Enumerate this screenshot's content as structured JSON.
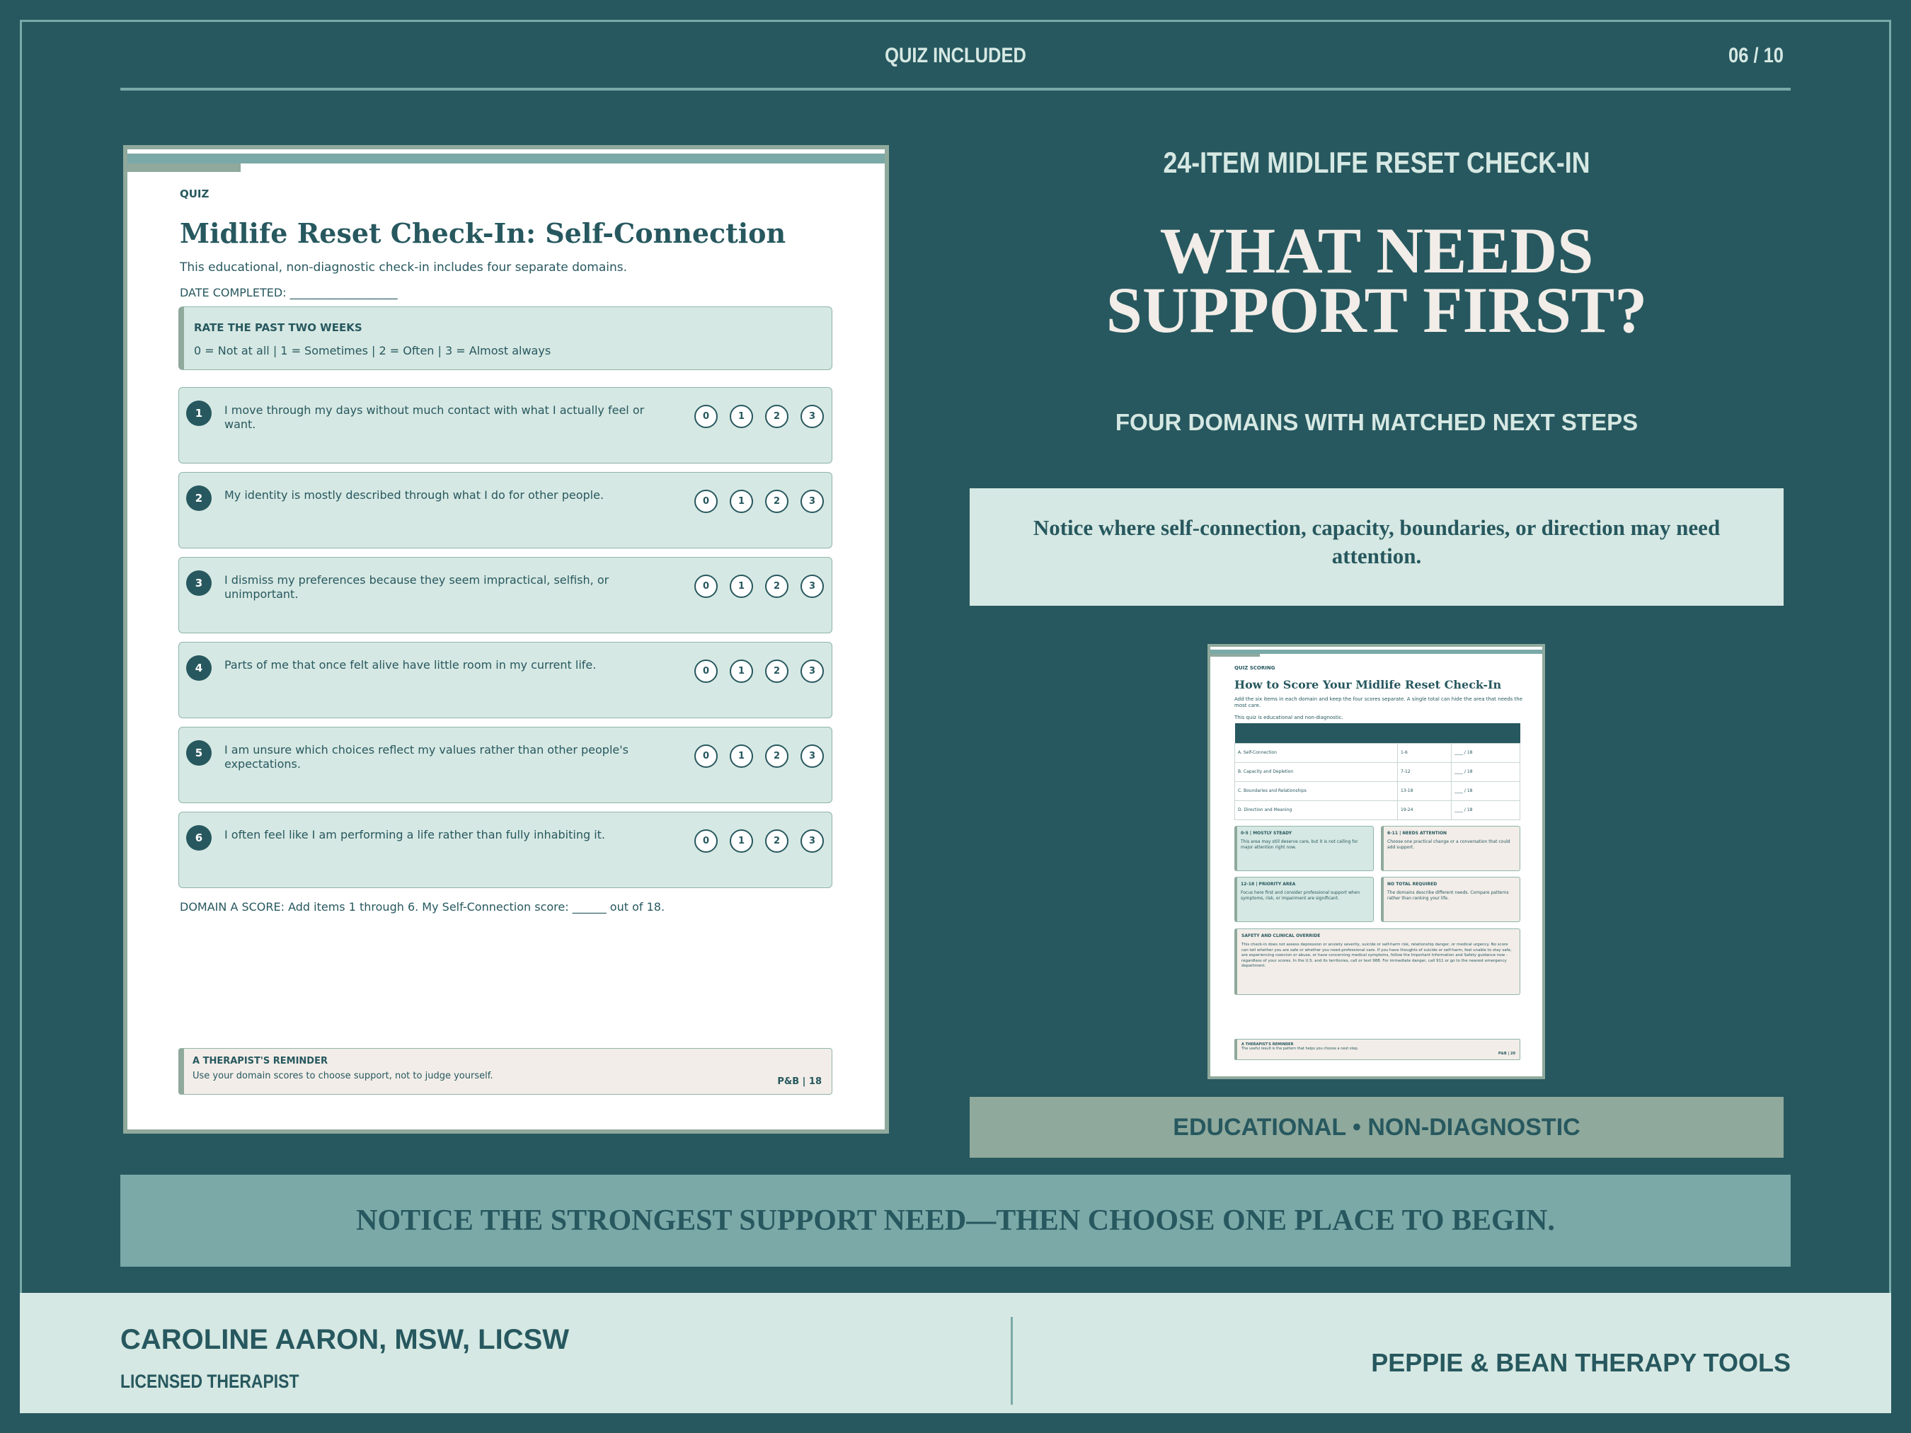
{
  "header": {
    "label": "QUIZ INCLUDED",
    "page": "06 / 10"
  },
  "doc": {
    "kicker": "QUIZ",
    "title": "Midlife Reset Check-In: Self-Connection",
    "subtitle": "This educational, non-diagnostic check-in includes four separate domains.",
    "date": "DATE COMPLETED: ___________________",
    "rate_title": "RATE THE PAST TWO WEEKS",
    "rate_scale": "0 = Not at all | 1 = Sometimes | 2 = Often | 3 = Almost always",
    "options": [
      "0",
      "1",
      "2",
      "3"
    ],
    "questions": [
      {
        "num": "1",
        "text": "I move through my days without much contact with what I actually feel or want."
      },
      {
        "num": "2",
        "text": "My identity is mostly described through what I do for other people."
      },
      {
        "num": "3",
        "text": "I dismiss my preferences because they seem impractical, selfish, or unimportant."
      },
      {
        "num": "4",
        "text": "Parts of me that once felt alive have little room in my current life."
      },
      {
        "num": "5",
        "text": "I am unsure which choices reflect my values rather than other people's expectations."
      },
      {
        "num": "6",
        "text": "I often feel like I am performing a life rather than fully inhabiting it."
      }
    ],
    "score": "DOMAIN A SCORE: Add items 1 through 6. My Self-Connection score: ______ out of 18.",
    "reminder_title": "A THERAPIST'S REMINDER",
    "reminder_text": "Use your domain scores to choose support, not to judge yourself.",
    "page_tag": "P&B | 18"
  },
  "right": {
    "kicker": "24-ITEM MIDLIFE RESET CHECK-IN",
    "headline_1": "WHAT NEEDS",
    "headline_2": "SUPPORT FIRST?",
    "subhead": "FOUR DOMAINS WITH MATCHED NEXT STEPS",
    "notice": "Notice where self-connection, capacity, boundaries, or direction may need attention.",
    "edu": "EDUCATIONAL • NON-DIAGNOSTIC"
  },
  "mini": {
    "kicker": "QUIZ SCORING",
    "title": "How to Score Your Midlife Reset Check-In",
    "desc": "Add the six items in each domain and keep the four scores separate. A single total can hide the area that needs the most care.",
    "desc2": "This quiz is educational and non-diagnostic.",
    "rows": [
      {
        "domain": "A. Self-Connection",
        "items": "1-6",
        "score": "____ / 18"
      },
      {
        "domain": "B. Capacity and Depletion",
        "items": "7-12",
        "score": "____ / 18"
      },
      {
        "domain": "C. Boundaries and Relationships",
        "items": "13-18",
        "score": "____ / 18"
      },
      {
        "domain": "D. Direction and Meaning",
        "items": "19-24",
        "score": "____ / 18"
      }
    ],
    "box1_h": "0-5 | MOSTLY STEADY",
    "box1_s": "This area may still deserve care, but it is not calling for major attention right now.",
    "box2_h": "6-11 | NEEDS ATTENTION",
    "box2_s": "Choose one practical change or a conversation that could add support.",
    "box3_h": "12-18 | PRIORITY AREA",
    "box3_s": "Focus here first and consider professional support when symptoms, risk, or impairment are significant.",
    "box4_h": "NO TOTAL REQUIRED",
    "box4_s": "The domains describe different needs. Compare patterns rather than ranking your life.",
    "safety_h": "SAFETY AND CLINICAL OVERRIDE",
    "safety_s": "This check-in does not assess depression or anxiety severity, suicide or self-harm risk, relationship danger, or medical urgency. No score can tell whether you are safe or whether you need professional care. If you have thoughts of suicide or self-harm, feel unable to stay safe, are experiencing coercion or abuse, or have concerning medical symptoms, follow the Important Information and Safety guidance now - regardless of your scores. In the U.S. and its territories, call or text 988. For immediate danger, call 911 or go to the nearest emergency department.",
    "rem_h": "A THERAPIST'S REMINDER",
    "rem_s": "The useful result is the pattern that helps you choose a next step.",
    "page_tag": "P&B | 20"
  },
  "banner": "NOTICE THE STRONGEST SUPPORT NEED—THEN CHOOSE ONE PLACE TO BEGIN.",
  "footer": {
    "name": "CAROLINE AARON, MSW, LICSW",
    "role": "LICENSED THERAPIST",
    "brand": "PEPPIE & BEAN THERAPY TOOLS"
  },
  "colors": {
    "background": "#27585f",
    "mint": "#d6e8e3",
    "teal": "#7aa9a8",
    "sage": "#8fa99c",
    "cream": "#f2ede8"
  }
}
